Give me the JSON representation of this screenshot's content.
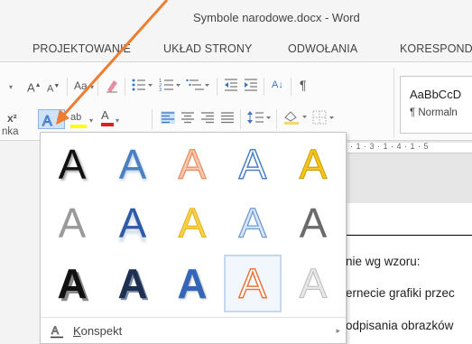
{
  "window": {
    "title": "Symbole narodowe.docx - Word"
  },
  "tabs": [
    "PROJEKTOWANIE",
    "UKŁAD STRONY",
    "ODWOŁANIA",
    "KORESPOND"
  ],
  "ribbon": {
    "font_grow": "A",
    "font_shrink": "A",
    "change_case": "Aa",
    "superscript": "x²",
    "highlight": "ab",
    "font_color": "A",
    "sort": "A↓",
    "pilcrow": "¶",
    "font_group_label": "nka"
  },
  "styles": {
    "sample": "AaBbCcD",
    "name": "¶ Normaln"
  },
  "ruler": {
    "marks": "· 1 · 3 · 1 · 4 · 1 · 5"
  },
  "document": {
    "lines": [
      "nie wg wzoru:",
      "ernecie grafiki przec",
      "odpisania obrazków"
    ]
  },
  "text_effects_gallery": {
    "glyph": "A",
    "menu_item": "Konspekt",
    "colors": {
      "black": "#111111",
      "blue": "#4a7fc1",
      "orange": "#f0a27a",
      "gold": "#f5c518",
      "gray": "#8c8c8c",
      "dark_blue": "#2e5aa8",
      "light_blue": "#a9c6e8",
      "selected_border": "#c5d8ef"
    }
  }
}
